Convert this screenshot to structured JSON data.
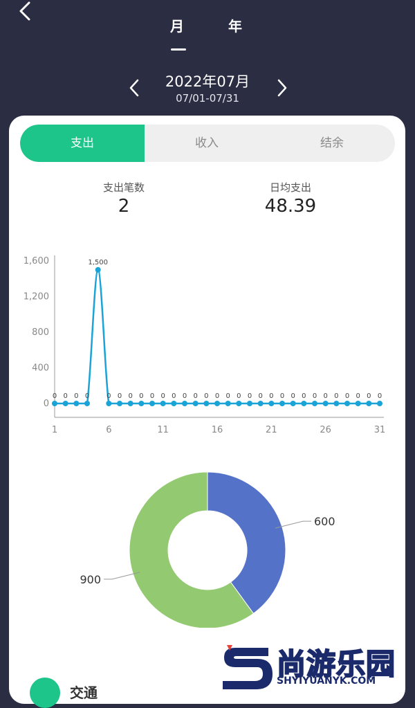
{
  "header": {
    "tabs": [
      {
        "label": "月"
      },
      {
        "label": "年"
      }
    ],
    "period": "2022年07月",
    "range": "07/01-07/31"
  },
  "segments": [
    {
      "label": "支出",
      "active": true
    },
    {
      "label": "收入",
      "active": false
    },
    {
      "label": "结余",
      "active": false
    }
  ],
  "stats": {
    "count_label": "支出笔数",
    "count_value": "2",
    "avg_label": "日均支出",
    "avg_value": "48.39"
  },
  "colors": {
    "accent": "#1dc58b",
    "line": "#1aa3d6",
    "donut_blue": "#5472c7",
    "donut_green": "#93c970",
    "background": "#2b2d42"
  },
  "chart_data": [
    {
      "type": "line",
      "x": [
        1,
        2,
        3,
        4,
        5,
        6,
        7,
        8,
        9,
        10,
        11,
        12,
        13,
        14,
        15,
        16,
        17,
        18,
        19,
        20,
        21,
        22,
        23,
        24,
        25,
        26,
        27,
        28,
        29,
        30,
        31
      ],
      "values": [
        0,
        0,
        0,
        0,
        1500,
        0,
        0,
        0,
        0,
        0,
        0,
        0,
        0,
        0,
        0,
        0,
        0,
        0,
        0,
        0,
        0,
        0,
        0,
        0,
        0,
        0,
        0,
        0,
        0,
        0,
        0
      ],
      "ylim": [
        0,
        1600
      ],
      "yticks": [
        "0",
        "400",
        "800",
        "1,200",
        "1,600"
      ],
      "yticks_values": [
        0,
        400,
        800,
        1200,
        1600
      ],
      "xticks": [
        "1",
        "6",
        "11",
        "16",
        "21",
        "26",
        "31"
      ],
      "xticks_values": [
        1,
        6,
        11,
        16,
        21,
        26,
        31
      ],
      "point_labels": [
        "0",
        "0",
        "0",
        "0",
        "1,500",
        "0",
        "0",
        "0",
        "0",
        "0",
        "0",
        "0",
        "0",
        "0",
        "0",
        "0",
        "0",
        "0",
        "0",
        "0",
        "0",
        "0",
        "0",
        "0",
        "0",
        "0",
        "0",
        "0",
        "0",
        "0",
        "0"
      ],
      "grid": false
    },
    {
      "type": "pie",
      "values": [
        600,
        900
      ],
      "labels": [
        "600",
        "900"
      ],
      "colors": [
        "#5472c7",
        "#93c970"
      ]
    }
  ],
  "list": [
    {
      "label": "交通"
    }
  ],
  "watermark": {
    "brand": "尚游乐园",
    "domain": "SHYIYUANYK.COM"
  },
  "icons": {
    "back": "chevron-left-icon",
    "prev": "chevron-left-icon",
    "next": "chevron-right-icon"
  }
}
